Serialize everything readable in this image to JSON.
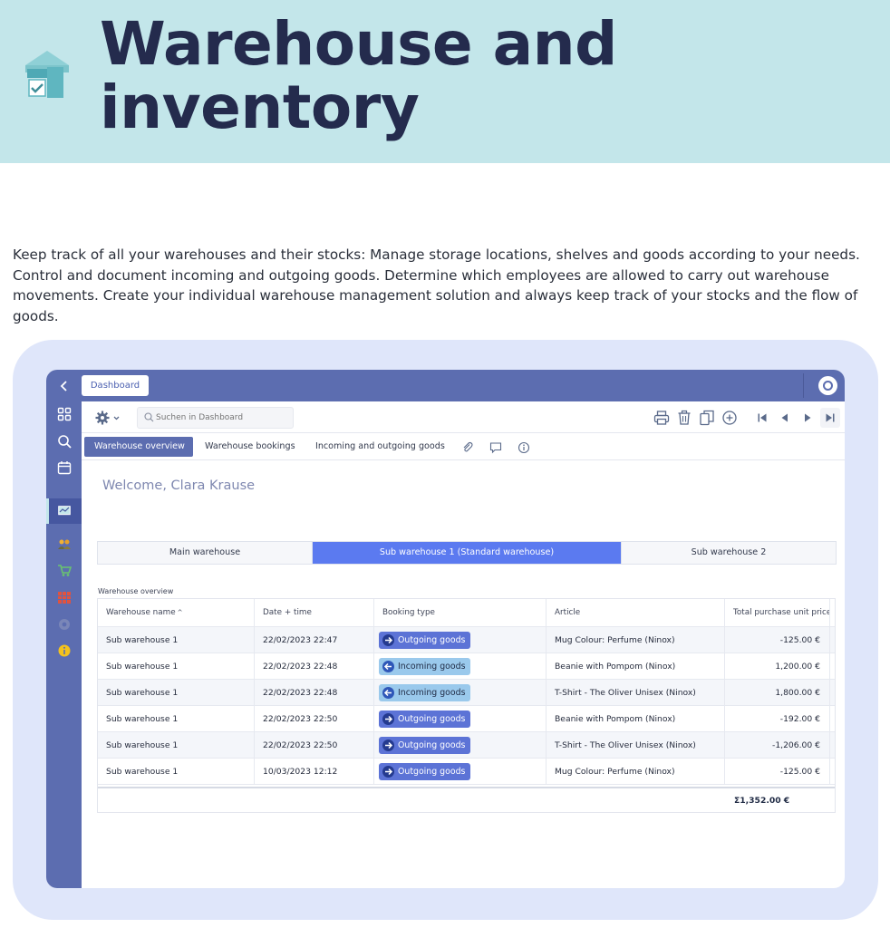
{
  "hero": {
    "title_line1": "Warehouse and",
    "title_line2": "inventory",
    "icon": "warehouse-icon"
  },
  "intro": "Keep track of all your warehouses and their stocks: Manage storage locations, shelves and goods according to your needs. Control and document incoming and outgoing goods. Determine which employees are allowed to carry out warehouse movements. Create your individual warehouse management solution and always keep track of your stocks and the flow of goods.",
  "app": {
    "back_icon": "‹",
    "open_tab": "Dashboard",
    "search_placeholder": "Suchen in Dashboard",
    "sidebar": [
      "grid-icon",
      "search-icon",
      "calendar-icon",
      "dashboard-icon",
      "users-icon",
      "cart-icon",
      "warehouse-shelves-icon",
      "settings-icon",
      "info-icon"
    ],
    "tabs": [
      "Warehouse overview",
      "Warehouse bookings",
      "Incoming and outgoing goods"
    ],
    "welcome": "Welcome, Clara Krause",
    "segments": [
      "Main warehouse",
      "Sub warehouse 1 (Standard warehouse)",
      "Sub warehouse 2"
    ],
    "grid_caption": "Warehouse overview",
    "columns": [
      "Warehouse name",
      "Date + time",
      "Booking type",
      "Article",
      "Total purchase unit price"
    ],
    "sort_indicator": "^",
    "rows": [
      {
        "warehouse": "Sub warehouse 1",
        "datetime": "22/02/2023 22:47",
        "type": "Outgoing goods",
        "article": "Mug Colour: Perfume (Ninox)",
        "price": "-125.00 €"
      },
      {
        "warehouse": "Sub warehouse 1",
        "datetime": "22/02/2023 22:48",
        "type": "Incoming goods",
        "article": "Beanie with Pompom (Ninox)",
        "price": "1,200.00 €"
      },
      {
        "warehouse": "Sub warehouse 1",
        "datetime": "22/02/2023 22:48",
        "type": "Incoming goods",
        "article": "T-Shirt - The Oliver Unisex (Ninox)",
        "price": "1,800.00 €"
      },
      {
        "warehouse": "Sub warehouse 1",
        "datetime": "22/02/2023 22:50",
        "type": "Outgoing goods",
        "article": "Beanie with Pompom (Ninox)",
        "price": "-192.00 €"
      },
      {
        "warehouse": "Sub warehouse 1",
        "datetime": "22/02/2023 22:50",
        "type": "Outgoing goods",
        "article": "T-Shirt - The Oliver Unisex (Ninox)",
        "price": "-1,206.00 €"
      },
      {
        "warehouse": "Sub warehouse 1",
        "datetime": "10/03/2023 12:12",
        "type": "Outgoing goods",
        "article": "Mug Colour: Perfume (Ninox)",
        "price": "-125.00 €"
      }
    ],
    "total": "Σ1,352.00 €",
    "colors": {
      "accent": "#5c6db0",
      "segment_active": "#5b7af0",
      "badge_out": "#5c73d6",
      "badge_in": "#9ac9ec",
      "hero_bg": "#c3e6ea"
    }
  }
}
